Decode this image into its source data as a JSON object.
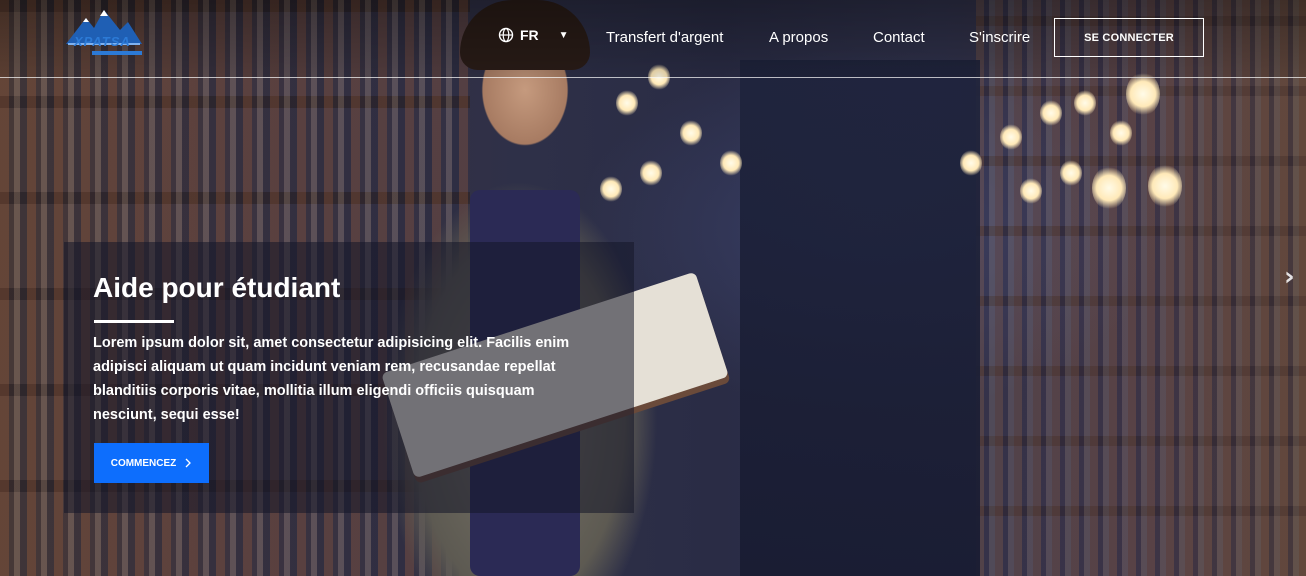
{
  "brand": {
    "name": "XPATSA"
  },
  "nav": {
    "language": "FR",
    "links": [
      "Transfert d'argent",
      "A propos",
      "Contact",
      "S'inscrire"
    ],
    "login_label": "SE CONNECTER"
  },
  "hero": {
    "title": "Aide pour étudiant",
    "body": "Lorem ipsum dolor sit, amet consectetur adipisicing elit. Facilis enim adipisci aliquam ut quam incidunt veniam rem, recusandae repellat blanditiis corporis vitae, mollitia illum eligendi officiis quisquam nesciunt, sequi esse!",
    "cta_label": "COMMENCEZ"
  },
  "colors": {
    "accent": "#0d6efd",
    "logo": "#2c7ad6"
  },
  "icons": {
    "language": "globe-icon",
    "lang_caret": "caret-down-icon",
    "cta": "chevron-right-icon",
    "carousel_next": "chevron-right-icon"
  }
}
